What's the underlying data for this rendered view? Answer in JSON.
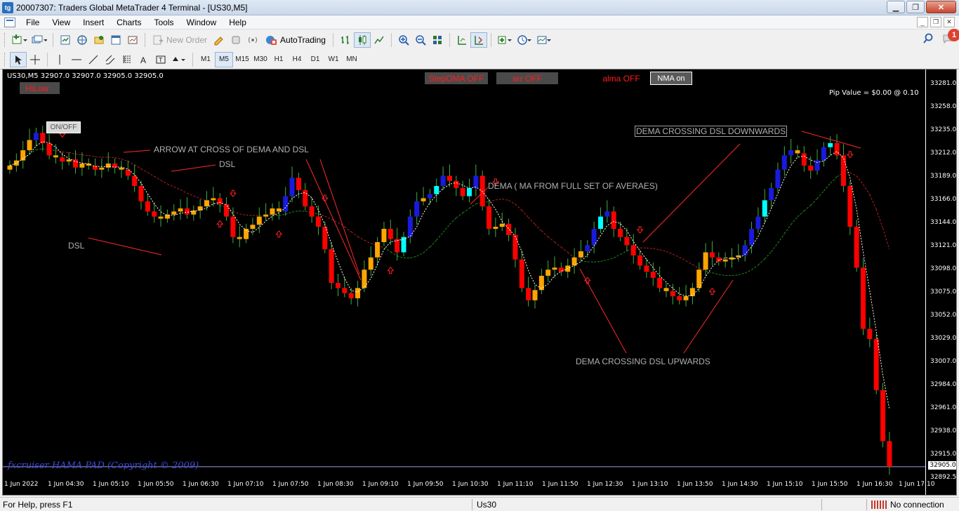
{
  "window": {
    "title": "20007307: Traders Global MetaTrader 4 Terminal - [US30,M5]",
    "app_icon_label": "tg"
  },
  "menu": [
    "File",
    "View",
    "Insert",
    "Charts",
    "Tools",
    "Window",
    "Help"
  ],
  "toolbar": {
    "new_order_label": "New Order",
    "autotrading_label": "AutoTrading",
    "notification_count": "1",
    "periods": [
      "M1",
      "M5",
      "M15",
      "M30",
      "H1",
      "H4",
      "D1",
      "W1",
      "MN"
    ],
    "active_period": "M5"
  },
  "chart": {
    "ohlc_header": "US30,M5  32907.0 32907.0 32905.0 32905.0",
    "buttons": {
      "hilow": "HiLow",
      "onoff": "ON/OFF",
      "stepma": "StepOMA OFF",
      "arr": "arr OFF",
      "alma": "alma OFF",
      "nma": "NMA on"
    },
    "pip_value": "Pip Value = $0.00 @ 0.10",
    "annotations": {
      "arrow_cross": "ARROW AT CROSS OF DEMA AND DSL",
      "dsl_top": "DSL",
      "dsl_left": "DSL",
      "dema": "DEMA ( MA FROM FULL SET OF AVERAES)",
      "dema_down": "DEMA CROSSING DSL DOWNWARDS",
      "dema_up": "DEMA CROSSING DSL UPWARDS"
    },
    "copyright": "fxcruiser HAMA PAD (Copyright © 2009)",
    "price_ticks": [
      "33281.0",
      "33258.0",
      "33235.0",
      "33212.0",
      "33189.0",
      "33166.0",
      "33144.0",
      "33121.0",
      "33098.0",
      "33075.0",
      "33052.0",
      "33029.0",
      "33007.0",
      "32984.0",
      "32961.0",
      "32938.0",
      "32915.0",
      "32892.5"
    ],
    "current_price": "32905.0",
    "time_ticks": [
      "1 Jun 2022",
      "1 Jun 04:30",
      "1 Jun 05:10",
      "1 Jun 05:50",
      "1 Jun 06:30",
      "1 Jun 07:10",
      "1 Jun 07:50",
      "1 Jun 08:30",
      "1 Jun 09:10",
      "1 Jun 09:50",
      "1 Jun 10:30",
      "1 Jun 11:10",
      "1 Jun 11:50",
      "1 Jun 12:30",
      "1 Jun 13:10",
      "1 Jun 13:50",
      "1 Jun 14:30",
      "1 Jun 15:10",
      "1 Jun 15:50",
      "1 Jun 16:30",
      "1 Jun 17:10"
    ],
    "colors": {
      "bull_strong": "#1a1adc",
      "bull_light": "#00ffff",
      "bear": "#ff0000",
      "neutral": "#ffa500",
      "dsl_up": "#228b22",
      "dsl_down": "#b22222",
      "dema": "#ffffe0"
    }
  },
  "chart_data": {
    "type": "candlestick",
    "symbol": "US30",
    "timeframe": "M5",
    "ylim": [
      32892.5,
      33290
    ],
    "close_series": [
      33200,
      33205,
      33215,
      33225,
      33232,
      33222,
      33210,
      33208,
      33204,
      33206,
      33198,
      33202,
      33200,
      33196,
      33198,
      33202,
      33198,
      33196,
      33190,
      33180,
      33165,
      33155,
      33150,
      33148,
      33152,
      33155,
      33158,
      33152,
      33156,
      33160,
      33166,
      33168,
      33162,
      33150,
      33130,
      33128,
      33138,
      33142,
      33150,
      33152,
      33158,
      33155,
      33170,
      33188,
      33176,
      33160,
      33150,
      33140,
      33118,
      33085,
      33080,
      33075,
      33070,
      33080,
      33098,
      33110,
      33125,
      33138,
      33128,
      33115,
      33130,
      33150,
      33165,
      33168,
      33172,
      33180,
      33190,
      33185,
      33178,
      33170,
      33178,
      33190,
      33160,
      33138,
      33140,
      33143,
      33132,
      33108,
      33080,
      33068,
      33078,
      33092,
      33098,
      33100,
      33096,
      33102,
      33110,
      33116,
      33122,
      33138,
      33150,
      33155,
      33138,
      33130,
      33122,
      33112,
      33102,
      33096,
      33090,
      33080,
      33077,
      33072,
      33068,
      33072,
      33080,
      33098,
      33115,
      33110,
      33106,
      33108,
      33110,
      33112,
      33122,
      33138,
      33150,
      33166,
      33178,
      33196,
      33210,
      33215,
      33212,
      33200,
      33195,
      33205,
      33218,
      33222,
      33210,
      33180,
      33140,
      33100,
      33040,
      33030,
      32980,
      32930,
      32905
    ]
  }
}
